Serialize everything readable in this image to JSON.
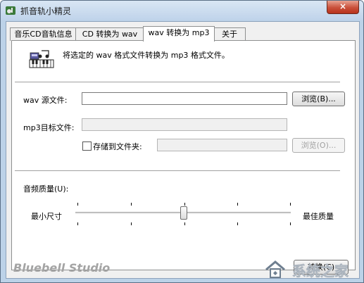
{
  "window": {
    "title": "抓音轨小精灵",
    "close_label": "×"
  },
  "tabs": [
    {
      "label": "音乐CD音轨信息",
      "active": false
    },
    {
      "label": "CD 转换为 wav",
      "active": false
    },
    {
      "label": "wav 转换为 mp3",
      "active": true
    },
    {
      "label": "关于",
      "active": false
    }
  ],
  "panel": {
    "description": "将选定的 wav 格式文件转换为 mp3 格式文件。",
    "source_label": "wav 源文件:",
    "source_value": "",
    "browse_label": "浏览(B)...",
    "target_label": "mp3目标文件:",
    "target_value": "",
    "save_to_folder_label": "存储到文件夹:",
    "save_to_folder_checked": false,
    "folder_value": "",
    "browse_folder_label": "浏览(O)...",
    "quality_label": "音频质量(U):",
    "quality_min_label": "最小尺寸",
    "quality_max_label": "最佳质量",
    "quality_level": 0.5
  },
  "footer": {
    "brand": "Bluebell Studio",
    "convert_label": "转换(C)",
    "watermark": "系统之家"
  },
  "icons": {
    "app": "app-icon",
    "description": "music-keyboard-icon",
    "watermark_logo": "house-logo-icon"
  }
}
